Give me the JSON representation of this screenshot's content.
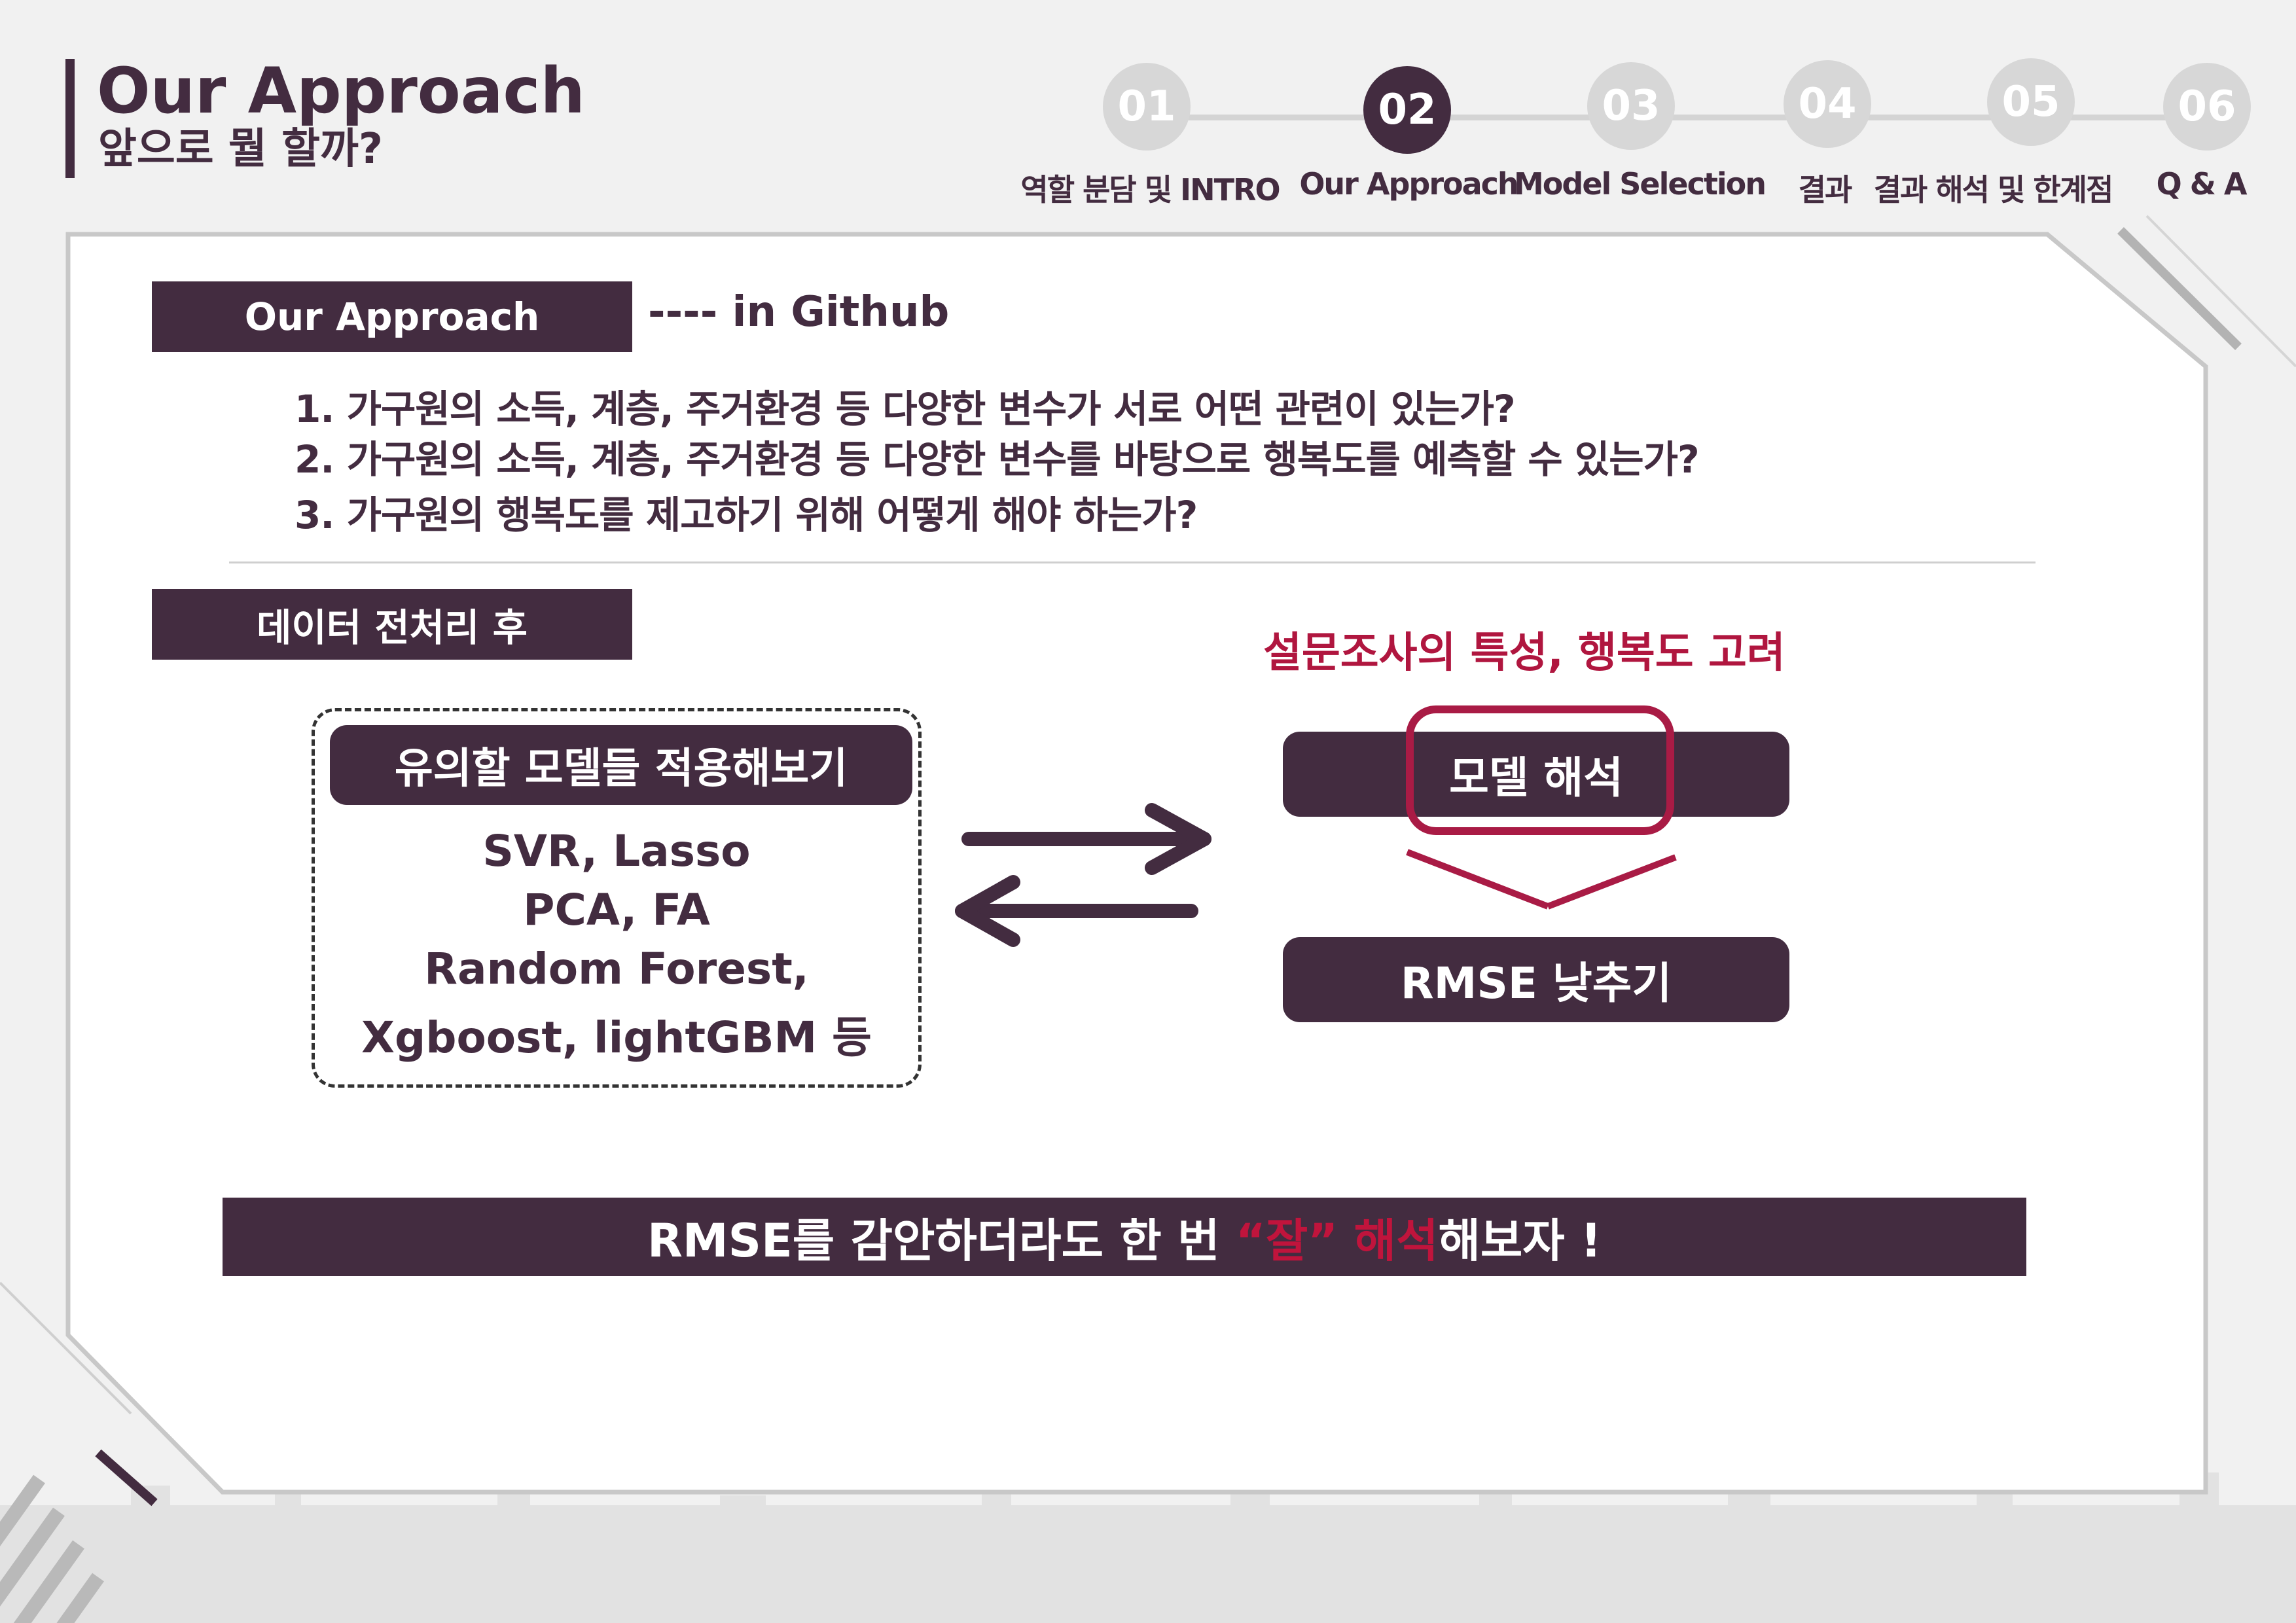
{
  "header": {
    "title": "Our Approach",
    "subtitle": "앞으로 뭘 할까?"
  },
  "stepper": {
    "steps": [
      {
        "number": "01",
        "label": "역할 분담 및 INTRO",
        "active": false
      },
      {
        "number": "02",
        "label": "Our Approach",
        "active": true
      },
      {
        "number": "03",
        "label": "Model Selection",
        "active": false
      },
      {
        "number": "04",
        "label": "결과",
        "active": false
      },
      {
        "number": "05",
        "label": "결과 해석 및 한계점",
        "active": false
      },
      {
        "number": "06",
        "label": "Q & A",
        "active": false
      }
    ]
  },
  "approach": {
    "label": "Our Approach",
    "note": "---- in Github",
    "questions": [
      "1. 가구원의 소득, 계층, 주거환경 등 다양한 변수가 서로 어떤 관련이 있는가?",
      "2. 가구원의 소득, 계층, 주거환경 등 다양한 변수를 바탕으로 행복도를 예측할 수 있는가?",
      "3. 가구원의 행복도를 제고하기 위해 어떻게 해야 하는가?"
    ]
  },
  "preprocess": {
    "label": "데이터 전처리 후",
    "consider_text": "설문조사의 특성, 행복도 고려",
    "models_box": {
      "header": "유의할 모델들 적용해보기",
      "lines": [
        "SVR, Lasso",
        "PCA, FA",
        "Random Forest,",
        "Xgboost, lightGBM   등"
      ]
    },
    "interpretation": "모델 해석",
    "rmse": "RMSE 낮추기"
  },
  "banner": {
    "prefix": "RMSE를 감안하더라도 한 번 ",
    "highlight": "“잘” 해석",
    "suffix": "해보자 !"
  },
  "colors": {
    "primary": "#432c40",
    "accent_red": "#b0163f",
    "step_inactive": "#d7d7d7",
    "background": "#f1f1f1"
  }
}
